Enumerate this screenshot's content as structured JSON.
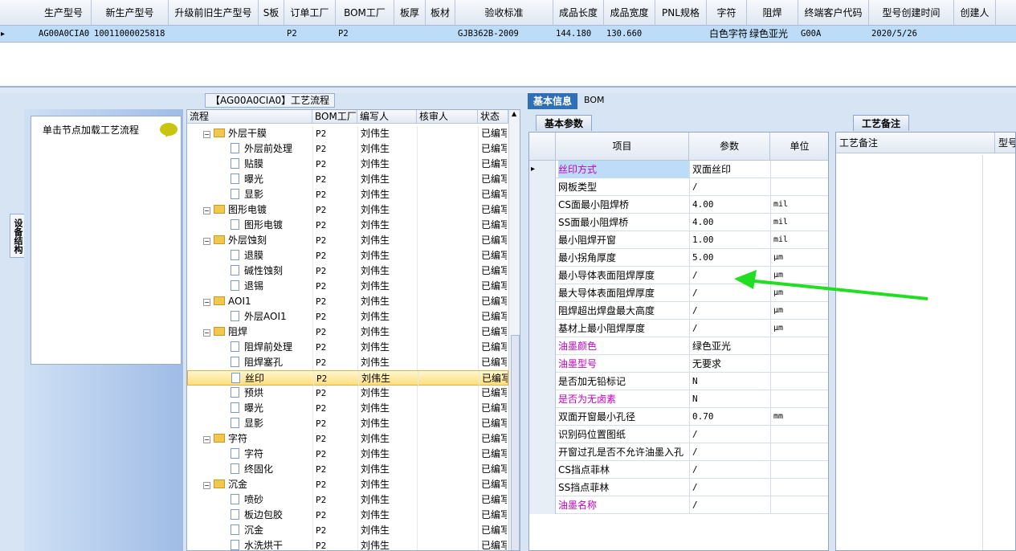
{
  "top_grid": {
    "headers": [
      "生产型号",
      "新生产型号",
      "升级前旧生产型号",
      "S板",
      "订单工厂",
      "BOM工厂",
      "板厚",
      "板材",
      "验收标准",
      "成品长度",
      "成品宽度",
      "PNL规格",
      "字符",
      "阻焊",
      "终端客户代码",
      "型号创建时间",
      "创建人"
    ],
    "row": [
      "AG00A0CIA0",
      "10011000025818",
      "",
      "",
      "P2",
      "P2",
      "",
      "",
      "GJB362B-2009",
      "144.180",
      "130.660",
      "",
      "白色字符",
      "绿色亚光",
      "G00A",
      "2020/5/26",
      ""
    ]
  },
  "left": {
    "vertical_tab": "设备结构",
    "hint_text": "单击节点加载工艺流程",
    "tree_title": "【AG00A0CIA0】工艺流程",
    "tree_headers": [
      "流程",
      "BOM工厂",
      "编写人",
      "核审人",
      "状态"
    ],
    "rows": [
      {
        "name": "外层干膜",
        "kind": "folder",
        "bom": "P2",
        "writer": "刘伟生",
        "status": "已编写"
      },
      {
        "name": "外层前处理",
        "kind": "doc",
        "bom": "P2",
        "writer": "刘伟生",
        "status": "已编写"
      },
      {
        "name": "贴膜",
        "kind": "doc",
        "bom": "P2",
        "writer": "刘伟生",
        "status": "已编写"
      },
      {
        "name": "曝光",
        "kind": "doc",
        "bom": "P2",
        "writer": "刘伟生",
        "status": "已编写"
      },
      {
        "name": "显影",
        "kind": "doc",
        "bom": "P2",
        "writer": "刘伟生",
        "status": "已编写"
      },
      {
        "name": "图形电镀",
        "kind": "folder",
        "bom": "P2",
        "writer": "刘伟生",
        "status": "已编写"
      },
      {
        "name": "图形电镀",
        "kind": "doc",
        "bom": "P2",
        "writer": "刘伟生",
        "status": "已编写"
      },
      {
        "name": "外层蚀刻",
        "kind": "folder",
        "bom": "P2",
        "writer": "刘伟生",
        "status": "已编写"
      },
      {
        "name": "退膜",
        "kind": "doc",
        "bom": "P2",
        "writer": "刘伟生",
        "status": "已编写"
      },
      {
        "name": "碱性蚀刻",
        "kind": "doc",
        "bom": "P2",
        "writer": "刘伟生",
        "status": "已编写"
      },
      {
        "name": "退锡",
        "kind": "doc",
        "bom": "P2",
        "writer": "刘伟生",
        "status": "已编写"
      },
      {
        "name": "AOI1",
        "kind": "folder",
        "bom": "P2",
        "writer": "刘伟生",
        "status": "已编写"
      },
      {
        "name": "外层AOI1",
        "kind": "doc",
        "bom": "P2",
        "writer": "刘伟生",
        "status": "已编写"
      },
      {
        "name": "阻焊",
        "kind": "folder",
        "bom": "P2",
        "writer": "刘伟生",
        "status": "已编写"
      },
      {
        "name": "阻焊前处理",
        "kind": "doc",
        "bom": "P2",
        "writer": "刘伟生",
        "status": "已编写"
      },
      {
        "name": "阻焊塞孔",
        "kind": "doc",
        "bom": "P2",
        "writer": "刘伟生",
        "status": "已编写"
      },
      {
        "name": "丝印",
        "kind": "doc",
        "bom": "P2",
        "writer": "刘伟生",
        "status": "已编写",
        "selected": true
      },
      {
        "name": "预烘",
        "kind": "doc",
        "bom": "P2",
        "writer": "刘伟生",
        "status": "已编写"
      },
      {
        "name": "曝光",
        "kind": "doc",
        "bom": "P2",
        "writer": "刘伟生",
        "status": "已编写"
      },
      {
        "name": "显影",
        "kind": "doc",
        "bom": "P2",
        "writer": "刘伟生",
        "status": "已编写"
      },
      {
        "name": "字符",
        "kind": "folder",
        "bom": "P2",
        "writer": "刘伟生",
        "status": "已编写"
      },
      {
        "name": "字符",
        "kind": "doc",
        "bom": "P2",
        "writer": "刘伟生",
        "status": "已编写"
      },
      {
        "name": "终固化",
        "kind": "doc",
        "bom": "P2",
        "writer": "刘伟生",
        "status": "已编写"
      },
      {
        "name": "沉金",
        "kind": "folder",
        "bom": "P2",
        "writer": "刘伟生",
        "status": "已编写"
      },
      {
        "name": "喷砂",
        "kind": "doc",
        "bom": "P2",
        "writer": "刘伟生",
        "status": "已编写"
      },
      {
        "name": "板边包胶",
        "kind": "doc",
        "bom": "P2",
        "writer": "刘伟生",
        "status": "已编写"
      },
      {
        "name": "沉金",
        "kind": "doc",
        "bom": "P2",
        "writer": "刘伟生",
        "status": "已编写"
      },
      {
        "name": "水洗烘干",
        "kind": "doc",
        "bom": "P2",
        "writer": "刘伟生",
        "status": "已编写"
      }
    ]
  },
  "right": {
    "tab_active": "基本信息",
    "tab_other": "BOM",
    "subtab_params": "基本参数",
    "subtab_notes": "工艺备注",
    "param_headers": [
      "项目",
      "参数",
      "单位"
    ],
    "notes_headers": [
      "工艺备注",
      "型号"
    ],
    "params": [
      {
        "item": "丝印方式",
        "value": "双面丝印",
        "unit": "",
        "highlight": true
      },
      {
        "item": "网板类型",
        "value": "/",
        "unit": ""
      },
      {
        "item": "CS面最小阻焊桥",
        "value": "4.00",
        "unit": "mil"
      },
      {
        "item": "SS面最小阻焊桥",
        "value": "4.00",
        "unit": "mil"
      },
      {
        "item": "最小阻焊开窗",
        "value": "1.00",
        "unit": "mil"
      },
      {
        "item": "最小拐角厚度",
        "value": "5.00",
        "unit": "μm"
      },
      {
        "item": "最小导体表面阻焊厚度",
        "value": "/",
        "unit": "μm"
      },
      {
        "item": "最大导体表面阻焊厚度",
        "value": "/",
        "unit": "μm"
      },
      {
        "item": "阻焊超出焊盘最大高度",
        "value": "/",
        "unit": "μm"
      },
      {
        "item": "基材上最小阻焊厚度",
        "value": "/",
        "unit": "μm"
      },
      {
        "item": "油墨颜色",
        "value": "绿色亚光",
        "unit": "",
        "magenta": true
      },
      {
        "item": "油墨型号",
        "value": "无要求",
        "unit": "",
        "magenta": true
      },
      {
        "item": "是否加无铅标记",
        "value": "N",
        "unit": ""
      },
      {
        "item": "是否为无卤素",
        "value": "N",
        "unit": "",
        "magenta": true
      },
      {
        "item": "双面开窗最小孔径",
        "value": "0.70",
        "unit": "mm"
      },
      {
        "item": "识别码位置图纸",
        "value": "/",
        "unit": ""
      },
      {
        "item": "开窗过孔是否不允许油墨入孔",
        "value": "/",
        "unit": ""
      },
      {
        "item": "CS挡点菲林",
        "value": "/",
        "unit": ""
      },
      {
        "item": "SS挡点菲林",
        "value": "/",
        "unit": ""
      },
      {
        "item": "油墨名称",
        "value": "/",
        "unit": "",
        "magenta": true
      }
    ]
  },
  "colors": {
    "arrow": "#22dd22",
    "magenta": "#c000c0",
    "accent": "#2f6fb8"
  }
}
